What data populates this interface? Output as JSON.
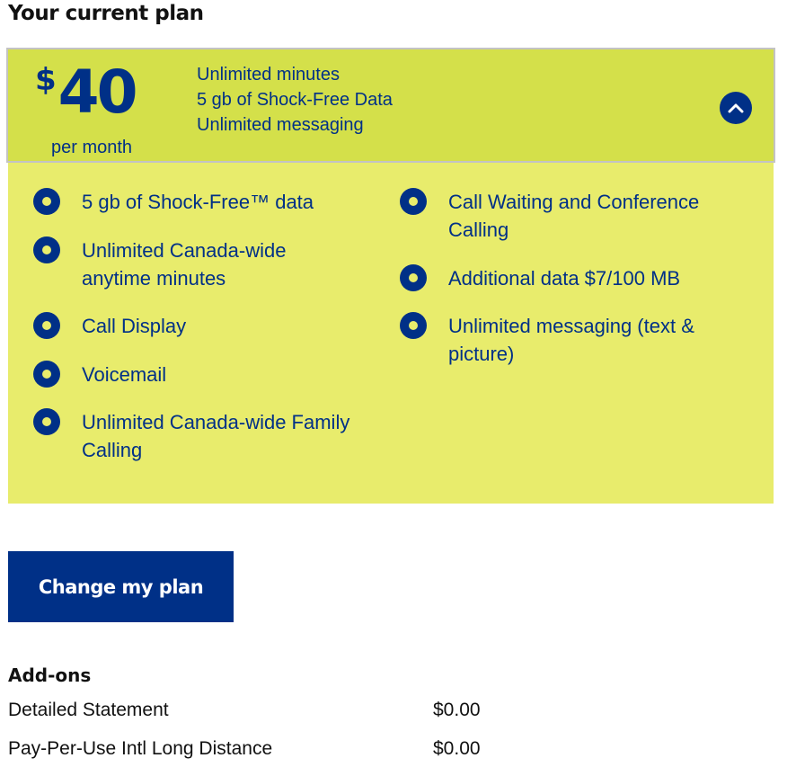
{
  "section_title": "Your current plan",
  "plan": {
    "currency_symbol": "$",
    "price": "40",
    "period": "per month",
    "summary": [
      "Unlimited minutes",
      "5 gb of Shock-Free Data",
      "Unlimited messaging"
    ],
    "collapse_icon": "chevron-up-icon",
    "features_left": [
      "5 gb of Shock-Free™ data",
      "Unlimited Canada-wide anytime minutes",
      "Call Display",
      "Voicemail",
      "Unlimited Canada-wide Family Calling"
    ],
    "features_right": [
      "Call Waiting and Conference Calling",
      "Additional data $7/100 MB",
      "Unlimited messaging (text & picture)"
    ]
  },
  "change_plan_label": "Change my plan",
  "addons": {
    "title": "Add-ons",
    "items": [
      {
        "name": "Detailed Statement",
        "price": "$0.00"
      },
      {
        "name": "Pay-Per-Use Intl Long Distance",
        "price": "$0.00"
      }
    ]
  },
  "colors": {
    "brand_blue": "#003087",
    "header_green": "#d4e04a",
    "details_yellow": "#e8ec6c"
  }
}
